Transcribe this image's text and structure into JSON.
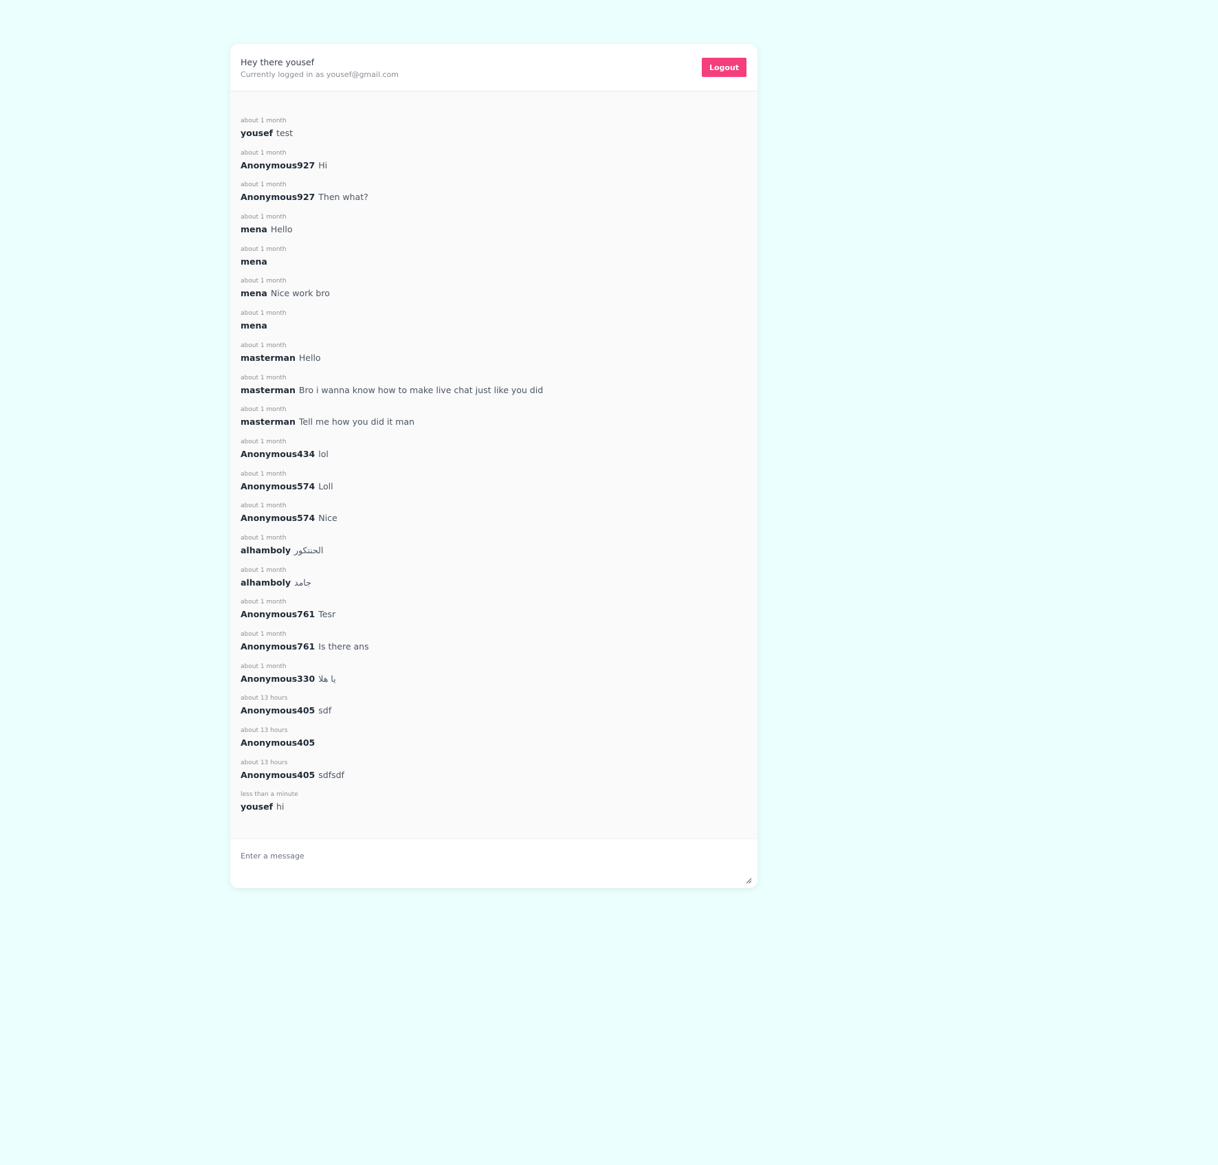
{
  "header": {
    "greeting": "Hey there yousef",
    "logged_in_as": "Currently logged in as yousef@gmail.com",
    "logout_label": "Logout"
  },
  "messages": [
    {
      "time": "about 1 month",
      "author": "yousef",
      "text": "test"
    },
    {
      "time": "about 1 month",
      "author": "Anonymous927",
      "text": "Hi"
    },
    {
      "time": "about 1 month",
      "author": "Anonymous927",
      "text": "Then what?"
    },
    {
      "time": "about 1 month",
      "author": "mena",
      "text": "Hello"
    },
    {
      "time": "about 1 month",
      "author": "mena",
      "text": ""
    },
    {
      "time": "about 1 month",
      "author": "mena",
      "text": "Nice work bro"
    },
    {
      "time": "about 1 month",
      "author": "mena",
      "text": ""
    },
    {
      "time": "about 1 month",
      "author": "masterman",
      "text": "Hello"
    },
    {
      "time": "about 1 month",
      "author": "masterman",
      "text": "Bro i wanna know how to make live chat just like you did"
    },
    {
      "time": "about 1 month",
      "author": "masterman",
      "text": "Tell me how you did it man"
    },
    {
      "time": "about 1 month",
      "author": "Anonymous434",
      "text": "lol"
    },
    {
      "time": "about 1 month",
      "author": "Anonymous574",
      "text": "Loll"
    },
    {
      "time": "about 1 month",
      "author": "Anonymous574",
      "text": "Nice"
    },
    {
      "time": "about 1 month",
      "author": "alhamboly",
      "text": "الحنتكور"
    },
    {
      "time": "about 1 month",
      "author": "alhamboly",
      "text": "جامد"
    },
    {
      "time": "about 1 month",
      "author": "Anonymous761",
      "text": "Tesr"
    },
    {
      "time": "about 1 month",
      "author": "Anonymous761",
      "text": "Is there ans"
    },
    {
      "time": "about 1 month",
      "author": "Anonymous330",
      "text": "يا هلا"
    },
    {
      "time": "about 13 hours",
      "author": "Anonymous405",
      "text": "sdf"
    },
    {
      "time": "about 13 hours",
      "author": "Anonymous405",
      "text": ""
    },
    {
      "time": "about 13 hours",
      "author": "Anonymous405",
      "text": "sdfsdf"
    },
    {
      "time": "less than a minute",
      "author": "yousef",
      "text": "hi"
    }
  ],
  "composer": {
    "placeholder": "Enter a message",
    "value": ""
  },
  "colors": {
    "page_background": "#ebfffe",
    "logout_button": "#f43f7c"
  }
}
